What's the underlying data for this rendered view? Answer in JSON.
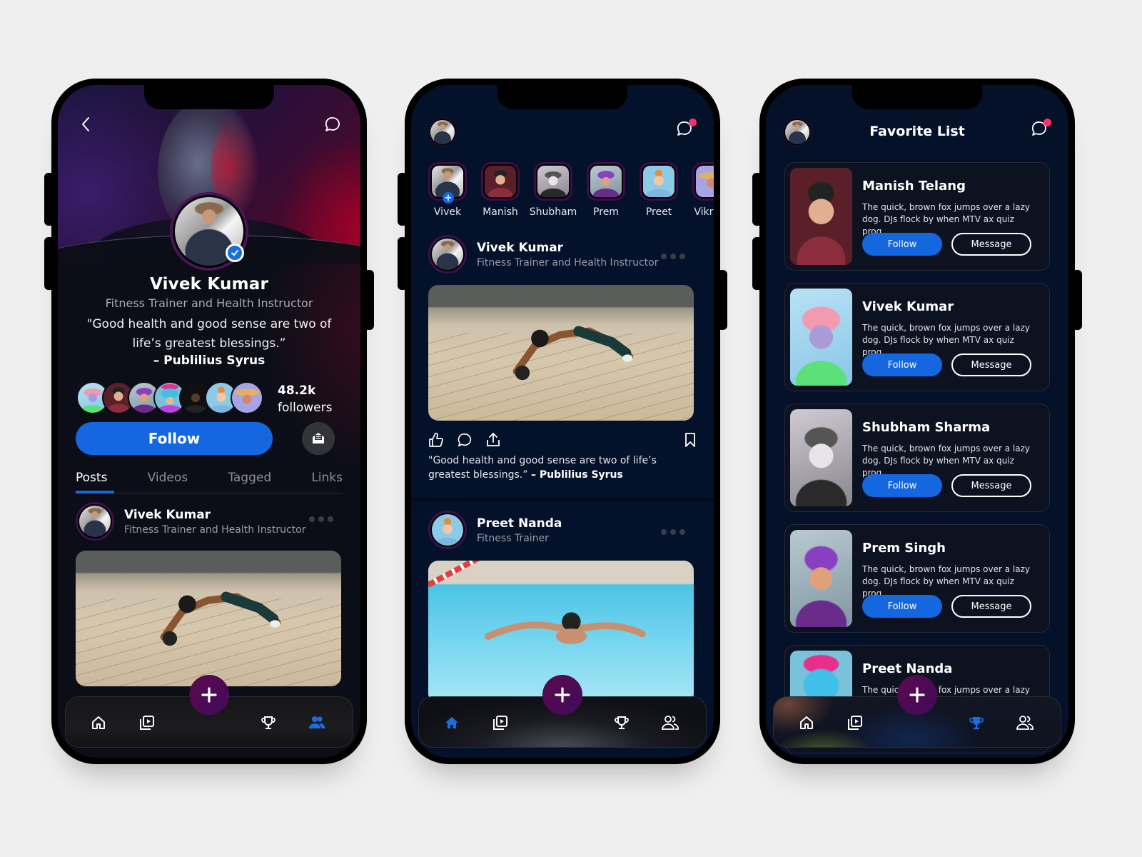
{
  "colors": {
    "accent_blue": "#1467df",
    "fab_purple": "#4a0b56",
    "notification_red": "#ff2d6e",
    "background": "#efefef"
  },
  "profile_screen": {
    "icons": {
      "back": "chevron-left-icon",
      "chat": "chat-bubble-icon",
      "verified": "check-badge-icon",
      "message": "envelope-open-icon"
    },
    "name": "Vivek Kumar",
    "role": "Fitness Trainer and Health Instructor",
    "quote": "\"Good health and good sense are two of life’s greatest blessings.”",
    "quote_author": "– Publilius Syrus",
    "followers_count": "48.2k",
    "followers_label": "followers",
    "follow_button": "Follow",
    "tabs": [
      {
        "label": "Posts",
        "active": true
      },
      {
        "label": "Videos",
        "active": false
      },
      {
        "label": "Tagged",
        "active": false
      },
      {
        "label": "Links",
        "active": false
      }
    ],
    "post": {
      "author": "Vivek Kumar",
      "role": "Fitness Trainer and Health Instructor",
      "image_alt": "Man doing ab roller exercise on a wooden deck"
    },
    "nav_active": "people"
  },
  "feed_screen": {
    "icons": {
      "chat": "chat-bubble-notification-icon"
    },
    "stories": [
      {
        "name": "Vivek",
        "own": true
      },
      {
        "name": "Manish"
      },
      {
        "name": "Shubham"
      },
      {
        "name": "Prem"
      },
      {
        "name": "Preet"
      },
      {
        "name": "Vikram"
      }
    ],
    "posts": [
      {
        "author": "Vivek Kumar",
        "role": "Fitness Trainer and Health Instructor",
        "image_alt": "Man doing ab roller exercise on a wooden deck",
        "caption": "\"Good health and good sense are two of life’s greatest blessings.”",
        "caption_author": "– Publilius Syrus"
      },
      {
        "author": "Preet Nanda",
        "role": "Fitness Trainer",
        "image_alt": "Swimmer doing butterfly stroke in an indoor pool"
      }
    ],
    "nav_active": "home"
  },
  "favorites_screen": {
    "title": "Favorite List",
    "follow_label": "Follow",
    "message_label": "Message",
    "items": [
      {
        "name": "Manish Telang",
        "desc": "The quick, brown fox jumps over a lazy dog. DJs flock by when MTV ax quiz prog..."
      },
      {
        "name": "Vivek Kumar",
        "desc": "The quick, brown fox jumps over a lazy dog. DJs flock by when MTV ax quiz prog..."
      },
      {
        "name": "Shubham Sharma",
        "desc": "The quick, brown fox jumps over a lazy dog. DJs flock by when MTV ax quiz prog..."
      },
      {
        "name": "Prem Singh",
        "desc": "The quick, brown fox jumps over a lazy dog. DJs flock by when MTV ax quiz prog..."
      },
      {
        "name": "Preet Nanda",
        "desc": "The quick, brown fox jumps over a lazy dog. DJs flock by when MTV ax quiz prog..."
      }
    ],
    "nav_active": "trophy"
  },
  "bottom_nav": {
    "items": [
      {
        "id": "home",
        "icon": "home-icon"
      },
      {
        "id": "video",
        "icon": "video-library-icon"
      },
      {
        "id": "trophy",
        "icon": "trophy-icon"
      },
      {
        "id": "people",
        "icon": "people-icon"
      }
    ],
    "fab_icon": "plus-icon"
  }
}
